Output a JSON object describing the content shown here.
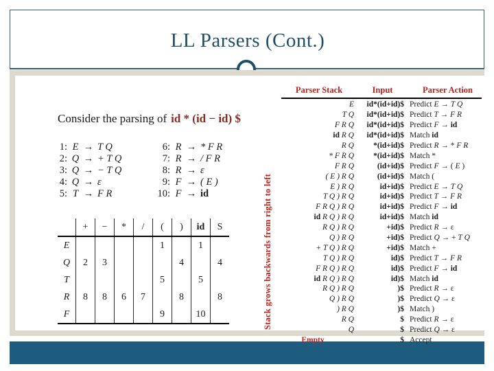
{
  "slide": {
    "title": "LL Parsers (Cont.)",
    "accent_teal": "#1f4e68",
    "accent_red": "#c0211b",
    "band_beige": "#ded9cd",
    "footer_blue": "#1d5c7e"
  },
  "left": {
    "consider_label": "Consider the parsing of",
    "consider_expression": "id * (id − id) $",
    "grammar_rules": [
      {
        "num": "1:",
        "lhs": "E",
        "arrow": "→",
        "rhs": "T Q"
      },
      {
        "num": "2:",
        "lhs": "Q",
        "arrow": "→",
        "rhs": "+ T Q"
      },
      {
        "num": "3:",
        "lhs": "Q",
        "arrow": "→",
        "rhs": "− T Q"
      },
      {
        "num": "4:",
        "lhs": "Q",
        "arrow": "→",
        "rhs": "ε"
      },
      {
        "num": "5:",
        "lhs": "T",
        "arrow": "→",
        "rhs": "F R"
      },
      {
        "num": "6:",
        "lhs": "R",
        "arrow": "→",
        "rhs": "* F R"
      },
      {
        "num": "7:",
        "lhs": "R",
        "arrow": "→",
        "rhs": "/ F R"
      },
      {
        "num": "8:",
        "lhs": "R",
        "arrow": "→",
        "rhs": "ε"
      },
      {
        "num": "9:",
        "lhs": "F",
        "arrow": "→",
        "rhs": "( E )"
      },
      {
        "num": "10:",
        "lhs": "F",
        "arrow": "→",
        "rhs": "id",
        "rhs_bold": true
      }
    ],
    "parse_table": {
      "corner": "",
      "columns": [
        "+",
        "−",
        "*",
        "/",
        "(",
        ")",
        "id",
        "S"
      ],
      "rows": [
        {
          "head": "E",
          "cells": [
            "",
            "",
            "",
            "",
            "1",
            "",
            "1",
            ""
          ]
        },
        {
          "head": "Q",
          "cells": [
            "2",
            "3",
            "",
            "",
            "",
            "4",
            "",
            "4"
          ]
        },
        {
          "head": "T",
          "cells": [
            "",
            "",
            "",
            "",
            "5",
            "",
            "5",
            ""
          ]
        },
        {
          "head": "R",
          "cells": [
            "8",
            "8",
            "6",
            "7",
            "",
            "8",
            "",
            "8"
          ]
        },
        {
          "head": "F",
          "cells": [
            "",
            "",
            "",
            "",
            "9",
            "",
            "10",
            ""
          ]
        }
      ]
    }
  },
  "right": {
    "vertical_caption": "Stack grows backwards from right to left",
    "headers": {
      "stack": "Parser Stack",
      "input": "Input",
      "action": "Parser Action"
    },
    "trace_rows": [
      {
        "stack": "E",
        "input": "id*(id+id)$",
        "action": "Predict E → T Q"
      },
      {
        "stack": "T Q",
        "input": "id*(id+id)$",
        "action": "Predict T → F R"
      },
      {
        "stack": "F R Q",
        "input": "id*(id+id)$",
        "action": "Predict F → id"
      },
      {
        "stack": "id R Q",
        "input": "id*(id+id)$",
        "action": "Match id"
      },
      {
        "stack": "R Q",
        "input": "*(id+id)$",
        "action": "Predict R → * F R"
      },
      {
        "stack": "* F R Q",
        "input": "*(id+id)$",
        "action": "Match *"
      },
      {
        "stack": "F R Q",
        "input": "(id+id)$",
        "action": "Predict F → ( E )"
      },
      {
        "stack": "( E ) R Q",
        "input": "(id+id)$",
        "action": "Match ("
      },
      {
        "stack": "E ) R Q",
        "input": "id+id)$",
        "action": "Predict E → T Q"
      },
      {
        "stack": "T Q ) R Q",
        "input": "id+id)$",
        "action": "Predict T → F R"
      },
      {
        "stack": "F R Q ) R Q",
        "input": "id+id)$",
        "action": "Predict F → id"
      },
      {
        "stack": "id R Q ) R Q",
        "input": "id+id)$",
        "action": "Match id"
      },
      {
        "stack": "R Q ) R Q",
        "input": "+id)$",
        "action": "Predict R → ε"
      },
      {
        "stack": "Q ) R Q",
        "input": "+id)$",
        "action": "Predict Q → + T Q"
      },
      {
        "stack": "+ T Q ) R Q",
        "input": "+id)$",
        "action": "Match +"
      },
      {
        "stack": "T Q ) R Q",
        "input": "id)$",
        "action": "Predict T → F R"
      },
      {
        "stack": "F R Q ) R Q",
        "input": "id)$",
        "action": "Predict F → id"
      },
      {
        "stack": "id R Q ) R Q",
        "input": "id)$",
        "action": "Match id"
      },
      {
        "stack": "R Q ) R Q",
        "input": ")$",
        "action": "Predict R → ε"
      },
      {
        "stack": "Q ) R Q",
        "input": ")$",
        "action": "Predict Q → ε"
      },
      {
        "stack": ") R Q",
        "input": ")$",
        "action": "Match )"
      },
      {
        "stack": "R Q",
        "input": "$",
        "action": "Predict R → ε"
      },
      {
        "stack": "Q",
        "input": "$",
        "action": "Predict Q → ε"
      },
      {
        "stack": "Empty",
        "input": "$",
        "action": "Accept",
        "final": true
      }
    ]
  }
}
